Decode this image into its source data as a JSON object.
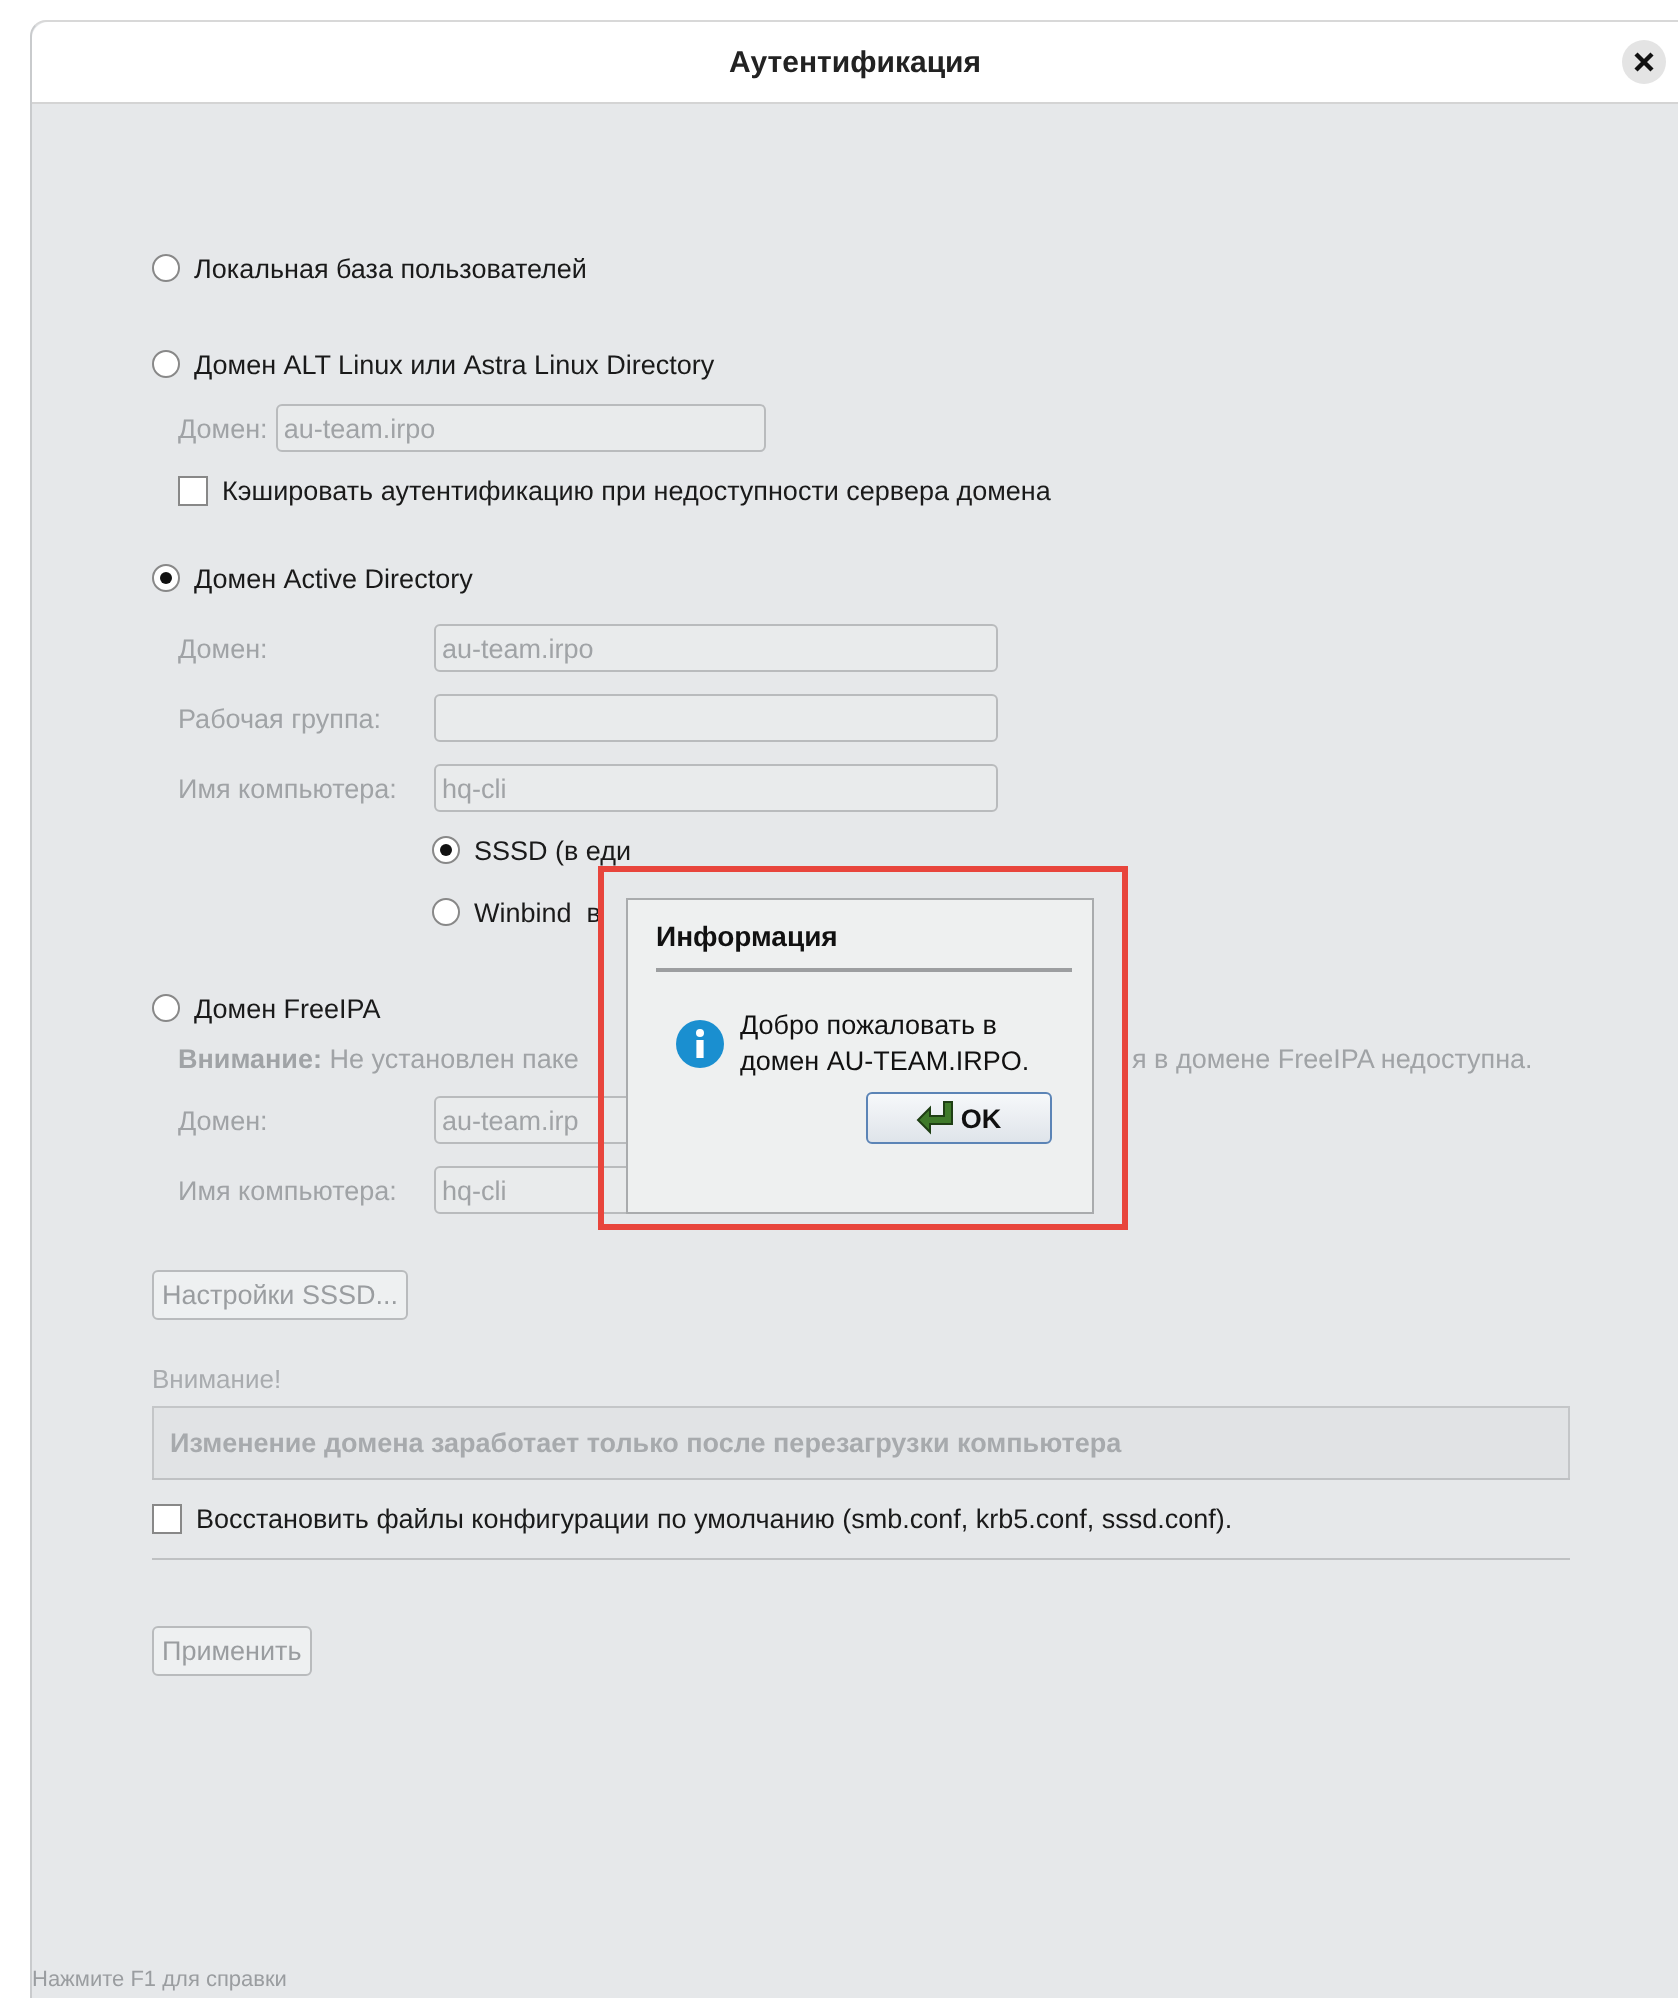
{
  "window": {
    "title": "Аутентификация"
  },
  "auth_options": [
    {
      "kind": "plain",
      "label": "Локальная база пользователей",
      "selected": false
    },
    {
      "kind": "compact",
      "label": "Домен ALT Linux или Astra Linux Directory",
      "selected": false,
      "fields": [
        {
          "label": "Домен:",
          "value": "au-team.irpo"
        }
      ],
      "checkbox": {
        "label": "Кэшировать аутентификацию при недоступности сервера домена",
        "checked": false
      }
    },
    {
      "kind": "grid",
      "label": "Домен Active Directory",
      "selected": true,
      "fields": [
        {
          "label": "Домен:",
          "value": "au-team.irpo"
        },
        {
          "label": "Рабочая группа:"
        },
        {
          "label": "Имя компьютера:",
          "value": "hq-cli"
        }
      ],
      "backends": [
        {
          "label": "SSSD (в еди",
          "selected": true
        },
        {
          "label": "Winbind  в",
          "selected": false
        }
      ]
    },
    {
      "kind": "grid",
      "label": "Домен FreeIPA",
      "selected": false,
      "warning": [
        "**Внимание:** Не установлен паке",
        "я в домене FreeIPA недоступна."
      ],
      "fields": [
        {
          "label": "Домен:",
          "value": "au-team.irp"
        },
        {
          "label": "Имя компьютера:",
          "value": "hq-cli"
        }
      ]
    }
  ],
  "sssd_button": "Настройки SSSD...",
  "notice": {
    "label": "Внимание!",
    "text": "Изменение домена заработает только после перезагрузки компьютера"
  },
  "restore": {
    "label": "Восстановить файлы конфигурации по умолчанию (smb.conf, krb5.conf, sssd.conf).",
    "checked": false
  },
  "apply_button": "Применить",
  "status_bar": "Нажмите F1 для справки",
  "message_box": {
    "title": "Информация",
    "text_lines": [
      "Добро пожаловать в",
      "домен AU-TEAM.IRPO."
    ],
    "button": "OK"
  }
}
